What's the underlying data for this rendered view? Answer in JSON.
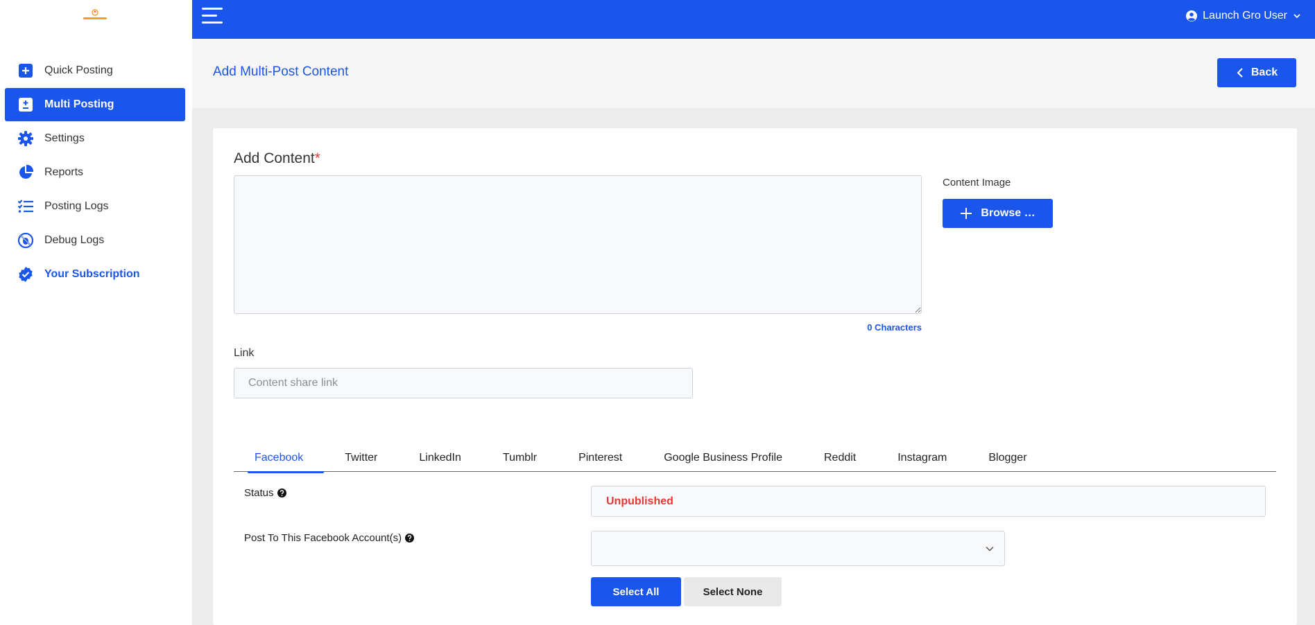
{
  "sidebar": {
    "items": [
      {
        "label": "Quick Posting",
        "icon": "plus-square-icon"
      },
      {
        "label": "Multi Posting",
        "icon": "plus-minus-square-icon"
      },
      {
        "label": "Settings",
        "icon": "gear-icon"
      },
      {
        "label": "Reports",
        "icon": "pie-chart-icon"
      },
      {
        "label": "Posting Logs",
        "icon": "checklist-icon"
      },
      {
        "label": "Debug Logs",
        "icon": "bug-slash-icon"
      },
      {
        "label": "Your Subscription",
        "icon": "verified-badge-icon"
      }
    ],
    "active_index": 1
  },
  "topbar": {
    "user_name": "Launch Gro User"
  },
  "header": {
    "title": "Add Multi-Post Content",
    "back_label": "Back"
  },
  "form": {
    "content_label": "Add Content",
    "required_mark": "*",
    "content_value": "",
    "char_count": "0 Characters",
    "image_label": "Content Image",
    "browse_label": "Browse …",
    "link_label": "Link",
    "link_value": "",
    "link_placeholder": "Content share link"
  },
  "tabs": [
    {
      "label": "Facebook"
    },
    {
      "label": "Twitter"
    },
    {
      "label": "LinkedIn"
    },
    {
      "label": "Tumblr"
    },
    {
      "label": "Pinterest"
    },
    {
      "label": "Google Business Profile"
    },
    {
      "label": "Reddit"
    },
    {
      "label": "Instagram"
    },
    {
      "label": "Blogger"
    }
  ],
  "active_tab": 0,
  "facebook": {
    "status_label": "Status",
    "status_value": "Unpublished",
    "account_label": "Post To This Facebook Account(s)",
    "account_value": "",
    "select_all_label": "Select All",
    "select_none_label": "Select None"
  },
  "colors": {
    "primary": "#1a56ec",
    "danger": "#e53935",
    "logo_accent": "#f0a020"
  }
}
